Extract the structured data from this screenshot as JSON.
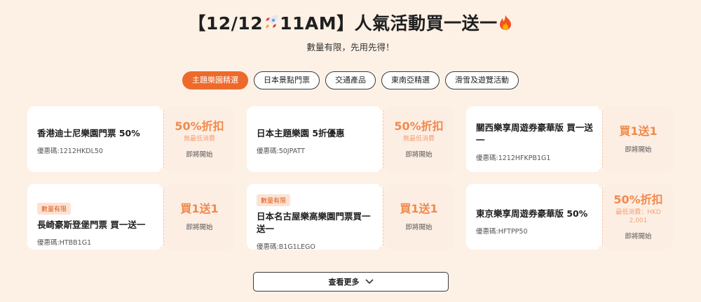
{
  "header": {
    "title_prefix": "【12/12",
    "title_time": "11AM】人氣活動買一送一",
    "subtitle": "數量有限，先用先得！"
  },
  "tabs": [
    {
      "label": "主題樂園精選",
      "active": true
    },
    {
      "label": "日本景點門票",
      "active": false
    },
    {
      "label": "交通產品",
      "active": false
    },
    {
      "label": "東南亞精選",
      "active": false
    },
    {
      "label": "滑雪及遊覽活動",
      "active": false
    }
  ],
  "coupons": [
    {
      "badge": "",
      "name": "香港迪士尼樂園門票 50%",
      "code": "優惠碼:1212HKDL50",
      "deal": "50%折扣",
      "min_spend": "無最低消費",
      "status": "即將開始"
    },
    {
      "badge": "",
      "name": "日本主題樂園 5折優惠",
      "code": "優惠碼:50JPATT",
      "deal": "50%折扣",
      "min_spend": "無最低消費",
      "status": "即將開始"
    },
    {
      "badge": "",
      "name": "關西樂享周遊券豪華版 買一送一",
      "code": "優惠碼:1212HFKPB1G1",
      "deal": "買1送1",
      "min_spend": "",
      "status": "即將開始"
    },
    {
      "badge": "數量有限",
      "name": "長崎豪斯登堡門票 買一送一",
      "code": "優惠碼:HTBB1G1",
      "deal": "買1送1",
      "min_spend": "",
      "status": "即將開始"
    },
    {
      "badge": "數量有限",
      "name": "日本名古屋樂高樂園門票買一送一",
      "code": "優惠碼:B1G1LEGO",
      "deal": "買1送1",
      "min_spend": "",
      "status": "即將開始"
    },
    {
      "badge": "",
      "name": "東京樂享周遊券豪華版 50%",
      "code": "優惠碼:HFTPP50",
      "deal": "50%折扣",
      "min_spend": "最低消費：HKD 2,001",
      "status": "即將開始"
    }
  ],
  "more_button": {
    "label": "查看更多",
    "icon": "chevron-down-icon"
  },
  "colors": {
    "accent": "#ee6a2c",
    "deal": "#f08a4b",
    "background": "#fdf1e6"
  }
}
